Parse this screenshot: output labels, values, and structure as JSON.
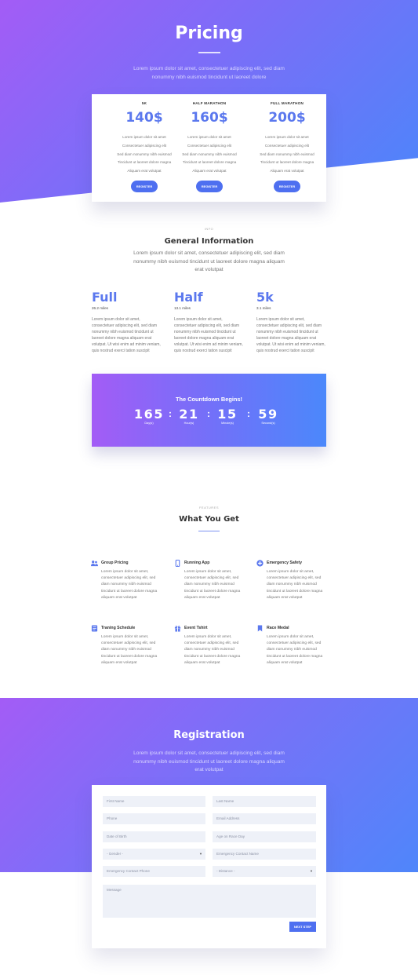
{
  "pricing": {
    "title": "Pricing",
    "intro": "Lorem ipsum dolor sit amet, consectetuer adipiscing elit, sed diam nonummy nibh euismod tincidunt ut laoreet dolore",
    "plans": [
      {
        "name": "5K",
        "price": "140$",
        "features": [
          "Lorem ipsum dolor sit amet",
          "Consectetuer adipiscing elit",
          "Sed diam nonummy nibh euismod",
          "Tincidunt ut laoreet dolore magna",
          "Aliquam erat volutpat"
        ],
        "button": "REGISTER"
      },
      {
        "name": "HALF MARATHON",
        "price": "160$",
        "features": [
          "Lorem ipsum dolor sit amet",
          "Consectetuer adipiscing elit",
          "Sed diam nonummy nibh euismod",
          "Tincidunt ut laoreet dolore magna",
          "Aliquam erat volutpat"
        ],
        "button": "REGISTER"
      },
      {
        "name": "FULL MARATHON",
        "price": "200$",
        "features": [
          "Lorem ipsum dolor sit amet",
          "Consectetuer adipiscing elit",
          "Sed diam nonummy nibh euismod",
          "Tincidunt ut laoreet dolore magna",
          "Aliquam erat volutpat"
        ],
        "button": "REGISTER"
      }
    ]
  },
  "info": {
    "eyebrow": "INFO",
    "title": "General Information",
    "text": "Lorem ipsum dolor sit amet, consectetuer adipiscing elit, sed diam nonummy nibh euismod tincidunt ut laoreet dolore magna aliquam erat volutpat",
    "distances": [
      {
        "name": "Full",
        "miles": "26.2 miles",
        "text": "Lorem ipsum dolor sit amet, consectetuer adipiscing elit, sed diam nonummy nibh euismod tincidunt ut laoreet dolore magna aliquam erat volutpat. Ut wisi enim ad minim veniam, quis nostrud exerci tation suscipit"
      },
      {
        "name": "Half",
        "miles": "13.1 miles",
        "text": "Lorem ipsum dolor sit amet, consectetuer adipiscing elit, sed diam nonummy nibh euismod tincidunt ut laoreet dolore magna aliquam erat volutpat. Ut wisi enim ad minim veniam, quis nostrud exerci tation suscipit"
      },
      {
        "name": "5k",
        "miles": "3.1 miles",
        "text": "Lorem ipsum dolor sit amet, consectetuer adipiscing elit, sed diam nonummy nibh euismod tincidunt ut laoreet dolore magna aliquam erat volutpat. Ut wisi enim ad minim veniam, quis nostrud exerci tation suscipit"
      }
    ]
  },
  "countdown": {
    "title": "The Countdown Begins!",
    "units": [
      {
        "value": "165",
        "label": "Day(s)"
      },
      {
        "value": "21",
        "label": "Hour(s)"
      },
      {
        "value": "15",
        "label": "Minute(s)"
      },
      {
        "value": "59",
        "label": "Second(s)"
      }
    ],
    "separator": ":"
  },
  "features": {
    "eyebrow": "FEATURES",
    "title": "What You Get",
    "items": [
      {
        "name": "Group Pricing",
        "icon": "group-icon",
        "text": "Lorem ipsum dolor sit amet, consectetuer adipiscing elit, sed diam nonummy nibh euismod tincidunt ut laoreet dolore magna aliquam erat volutpat"
      },
      {
        "name": "Running App",
        "icon": "phone-icon",
        "text": "Lorem ipsum dolor sit amet, consectetuer adipiscing elit, sed diam nonummy nibh euismod tincidunt ut laoreet dolore magna aliquam erat volutpat"
      },
      {
        "name": "Emergency Safety",
        "icon": "plus-circle-icon",
        "text": "Lorem ipsum dolor sit amet, consectetuer adipiscing elit, sed diam nonummy nibh euismod tincidunt ut laoreet dolore magna aliquam erat volutpat"
      },
      {
        "name": "Traning Schedule",
        "icon": "schedule-icon",
        "text": "Lorem ipsum dolor sit amet, consectetuer adipiscing elit, sed diam nonummy nibh euismod tincidunt ut laoreet dolore magna aliquam erat volutpat"
      },
      {
        "name": "Event Tshirt",
        "icon": "gift-icon",
        "text": "Lorem ipsum dolor sit amet, consectetuer adipiscing elit, sed diam nonummy nibh euismod tincidunt ut laoreet dolore magna aliquam erat volutpat"
      },
      {
        "name": "Race Medal",
        "icon": "bookmark-icon",
        "text": "Lorem ipsum dolor sit amet, consectetuer adipiscing elit, sed diam nonummy nibh euismod tincidunt ut laoreet dolore magna aliquam erat volutpat"
      }
    ]
  },
  "registration": {
    "title": "Registration",
    "intro": "Lorem ipsum dolor sit amet, consectetuer adipiscing elit, sed diam nonummy nibh euismod tincidunt ut laoreet dolore magna aliquam erat volutpat",
    "fields": {
      "first_name": "First Name",
      "last_name": "Last Name",
      "phone": "Phone",
      "email": "Email Address",
      "dob": "Date of Birth",
      "age": "Age on Race Day",
      "gender": "- Gender -",
      "emergency_name": "Emergency Contact Name",
      "emergency_phone": "Emergency Contact Phone",
      "distance": "- Distance -",
      "message": "Message"
    },
    "next_button": "NEXT STEP"
  },
  "colors": {
    "accent": "#4e6ff0",
    "gradient_start": "#a35cf6",
    "gradient_end": "#4b86fa"
  }
}
